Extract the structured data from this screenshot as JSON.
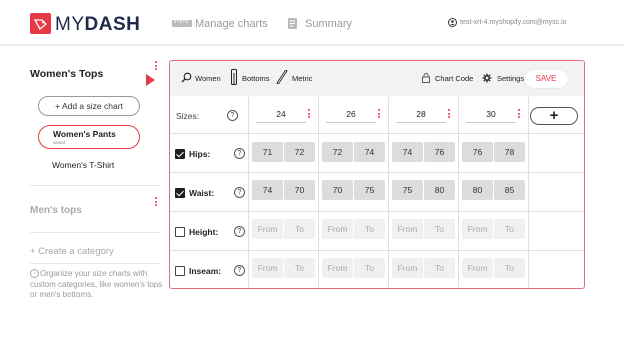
{
  "header": {
    "logo_my": "MY",
    "logo_dash": "DASH",
    "nav": [
      {
        "label": "Manage charts",
        "icon": "ruler-icon"
      },
      {
        "label": "Summary",
        "icon": "document-icon"
      }
    ],
    "user_email": "test-xrt-4.myshopify.com@mysc.io"
  },
  "sidebar": {
    "category1": "Women's Tops",
    "add_button": "+ Add a size chart",
    "items": [
      {
        "label": "Women's Pants",
        "status": "saved",
        "selected": true
      },
      {
        "label": "Women's T-Shirt",
        "selected": false
      }
    ],
    "category2": "Men's tops",
    "create_category": "+ Create a category",
    "hint": "Organize your size charts with custom categories, like women's tops or men's bottoms."
  },
  "toolbar": {
    "women": "Women",
    "bottoms": "Bottoms",
    "metric": "Metric",
    "chart_code": "Chart Code",
    "settings": "Settings",
    "save": "SAVE"
  },
  "table": {
    "sizes_label": "Sizes:",
    "sizes": [
      "24",
      "26",
      "28",
      "30"
    ],
    "rows": [
      {
        "label": "Hips:",
        "checked": true,
        "values": [
          [
            "71",
            "72"
          ],
          [
            "72",
            "74"
          ],
          [
            "74",
            "76"
          ],
          [
            "76",
            "78"
          ]
        ]
      },
      {
        "label": "Waist:",
        "checked": true,
        "values": [
          [
            "74",
            "70"
          ],
          [
            "70",
            "75"
          ],
          [
            "75",
            "80"
          ],
          [
            "80",
            "85"
          ]
        ]
      },
      {
        "label": "Height:",
        "checked": false,
        "values": [
          [
            "From",
            "To"
          ],
          [
            "From",
            "To"
          ],
          [
            "From",
            "To"
          ],
          [
            "From",
            "To"
          ]
        ]
      },
      {
        "label": "Inseam:",
        "checked": false,
        "values": [
          [
            "From",
            "To"
          ],
          [
            "From",
            "To"
          ],
          [
            "From",
            "To"
          ],
          [
            "From",
            "To"
          ]
        ]
      }
    ],
    "add_column": "+"
  },
  "colors": {
    "accent": "#e63946",
    "brand_text": "#1e2a4a"
  }
}
